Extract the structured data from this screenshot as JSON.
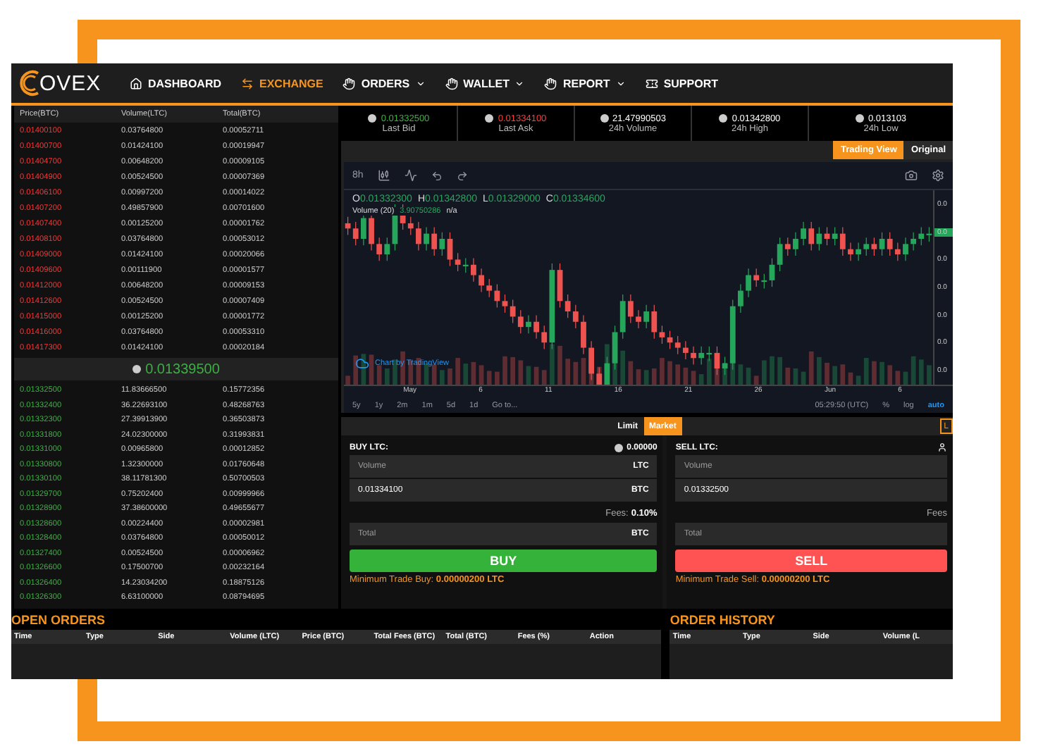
{
  "nav": {
    "logo": "OVEX",
    "items": [
      {
        "label": "DASHBOARD",
        "selected": false,
        "dropdown": false
      },
      {
        "label": "EXCHANGE",
        "selected": true,
        "dropdown": false
      },
      {
        "label": "ORDERS",
        "selected": false,
        "dropdown": true
      },
      {
        "label": "WALLET",
        "selected": false,
        "dropdown": true
      },
      {
        "label": "REPORT",
        "selected": false,
        "dropdown": true
      },
      {
        "label": "SUPPORT",
        "selected": false,
        "dropdown": false
      }
    ]
  },
  "order_book": {
    "columns": [
      "Price(BTC)",
      "Volume(LTC)",
      "Total(BTC)"
    ],
    "asks": [
      [
        "0.01400100",
        "0.03764800",
        "0.00052711"
      ],
      [
        "0.01400700",
        "0.01424100",
        "0.00019947"
      ],
      [
        "0.01404700",
        "0.00648200",
        "0.00009105"
      ],
      [
        "0.01404900",
        "0.00524500",
        "0.00007369"
      ],
      [
        "0.01406100",
        "0.00997200",
        "0.00014022"
      ],
      [
        "0.01407200",
        "0.49857900",
        "0.00701600"
      ],
      [
        "0.01407400",
        "0.00125200",
        "0.00001762"
      ],
      [
        "0.01408100",
        "0.03764800",
        "0.00053012"
      ],
      [
        "0.01409000",
        "0.01424100",
        "0.00020066"
      ],
      [
        "0.01409600",
        "0.00111900",
        "0.00001577"
      ],
      [
        "0.01412000",
        "0.00648200",
        "0.00009153"
      ],
      [
        "0.01412600",
        "0.00524500",
        "0.00007409"
      ],
      [
        "0.01415000",
        "0.00125200",
        "0.00001772"
      ],
      [
        "0.01416000",
        "0.03764800",
        "0.00053310"
      ],
      [
        "0.01417300",
        "0.01424100",
        "0.00020184"
      ]
    ],
    "last_price": "0.01339500",
    "bids": [
      [
        "0.01332500",
        "11.83666500",
        "0.15772356"
      ],
      [
        "0.01332400",
        "36.22693100",
        "0.48268763"
      ],
      [
        "0.01332300",
        "27.39913900",
        "0.36503873"
      ],
      [
        "0.01331800",
        "24.02300000",
        "0.31993831"
      ],
      [
        "0.01331000",
        "0.00965800",
        "0.00012852"
      ],
      [
        "0.01330800",
        "1.32300000",
        "0.01760648"
      ],
      [
        "0.01330100",
        "38.11781300",
        "0.50700503"
      ],
      [
        "0.01329700",
        "0.75202400",
        "0.00999966"
      ],
      [
        "0.01328900",
        "37.38600000",
        "0.49655677"
      ],
      [
        "0.01328600",
        "0.00224400",
        "0.00002981"
      ],
      [
        "0.01328400",
        "0.03764800",
        "0.00050012"
      ],
      [
        "0.01327400",
        "0.00524500",
        "0.00006962"
      ],
      [
        "0.01326600",
        "0.17500700",
        "0.00232164"
      ],
      [
        "0.01326400",
        "14.23034200",
        "0.18875126"
      ],
      [
        "0.01326300",
        "6.63100000",
        "0.08794695"
      ]
    ]
  },
  "stats": [
    {
      "value": "0.01332500",
      "label": "Last Bid",
      "kind": "up"
    },
    {
      "value": "0.01334100",
      "label": "Last Ask",
      "kind": "down"
    },
    {
      "value": "21.47990503",
      "label": "24h Volume",
      "kind": "plain"
    },
    {
      "value": "0.01342800",
      "label": "24h High",
      "kind": "plain"
    },
    {
      "value": "0.013103",
      "label": "24h Low",
      "kind": "plain"
    }
  ],
  "chart_tabs": [
    {
      "label": "Trading View",
      "selected": true
    },
    {
      "label": "Original",
      "selected": false
    }
  ],
  "chart": {
    "interval": "8h",
    "legend": [
      {
        "key": "O",
        "value": "0.01332300"
      },
      {
        "key": "H",
        "value": "0.01342800"
      },
      {
        "key": "L",
        "value": "0.01329000"
      },
      {
        "key": "C",
        "value": "0.01334600"
      }
    ],
    "volume_label": "Volume (20)",
    "volume_value": "3.90750286",
    "volume_na": "n/a",
    "credit": "Chart by TradingView",
    "y_labels": [
      "0.0",
      "0.0",
      "0.0",
      "0.0",
      "0.0",
      "0.0",
      "0.0"
    ],
    "x_labels": [
      "May",
      "6",
      "11",
      "16",
      "21",
      "26",
      "Jun",
      "6"
    ],
    "ranges": [
      {
        "label": "5y",
        "selected": false
      },
      {
        "label": "1y",
        "selected": false
      },
      {
        "label": "2m",
        "selected": false
      },
      {
        "label": "1m",
        "selected": false
      },
      {
        "label": "5d",
        "selected": false
      },
      {
        "label": "1d",
        "selected": false
      },
      {
        "label": "Go to...",
        "selected": false
      }
    ],
    "time": "05:29:50 (UTC)",
    "scales": [
      {
        "label": "%",
        "selected": false
      },
      {
        "label": "log",
        "selected": false
      },
      {
        "label": "auto",
        "selected": true
      }
    ]
  },
  "order_types": [
    {
      "label": "Limit",
      "selected": false
    },
    {
      "label": "Market",
      "selected": true
    }
  ],
  "sell_order_types": [
    {
      "label": "L",
      "selected": false
    }
  ],
  "buy": {
    "title": "BUY LTC:",
    "balance": "0.00000",
    "volume_placeholder": "Volume",
    "volume_unit": "LTC",
    "price": "0.01334100",
    "price_unit": "BTC",
    "fees_label": "Fees:",
    "fees": "0.10%",
    "total_placeholder": "Total",
    "total_unit": "BTC",
    "button": "BUY",
    "minimum": "Minimum Trade Buy: **0.00000200 LTC**"
  },
  "sell": {
    "title": "SELL LTC:",
    "volume_placeholder": "Volume",
    "price": "0.01332500",
    "fees_label": "Fees",
    "total_placeholder": "Total",
    "button": "SELL",
    "minimum": "Minimum Trade Sell: **0.00000200 LTC**"
  },
  "open_orders": {
    "title": "OPEN ORDERS",
    "columns": [
      "Time",
      "Type",
      "Side",
      "Volume (LTC)",
      "Price (BTC)",
      "Total Fees (BTC)",
      "Total (BTC)",
      "Fees (%)",
      "Action"
    ]
  },
  "order_history": {
    "title": "ORDER HISTORY",
    "columns": [
      "Time",
      "Type",
      "Side",
      "Volume (L"
    ]
  }
}
